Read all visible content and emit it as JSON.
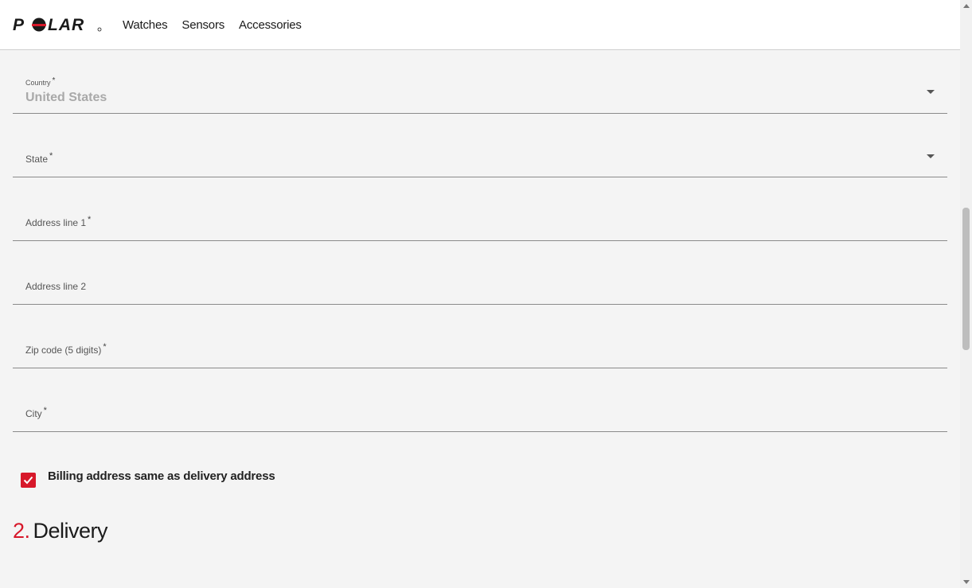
{
  "header": {
    "logo_text": "POLAR",
    "nav": [
      {
        "label": "Watches"
      },
      {
        "label": "Sensors"
      },
      {
        "label": "Accessories"
      }
    ]
  },
  "form": {
    "country": {
      "label": "Country",
      "required": "*",
      "value": "United States"
    },
    "state": {
      "label": "State",
      "required": "*"
    },
    "address1": {
      "label": "Address line 1",
      "required": "*"
    },
    "address2": {
      "label": "Address line 2"
    },
    "zip": {
      "label": "Zip code (5 digits)",
      "required": "*"
    },
    "city": {
      "label": "City",
      "required": "*"
    }
  },
  "billing_same": {
    "label": "Billing address same as delivery address",
    "checked": true
  },
  "section": {
    "number": "2.",
    "title": "Delivery"
  },
  "colors": {
    "accent": "#d7182a"
  }
}
